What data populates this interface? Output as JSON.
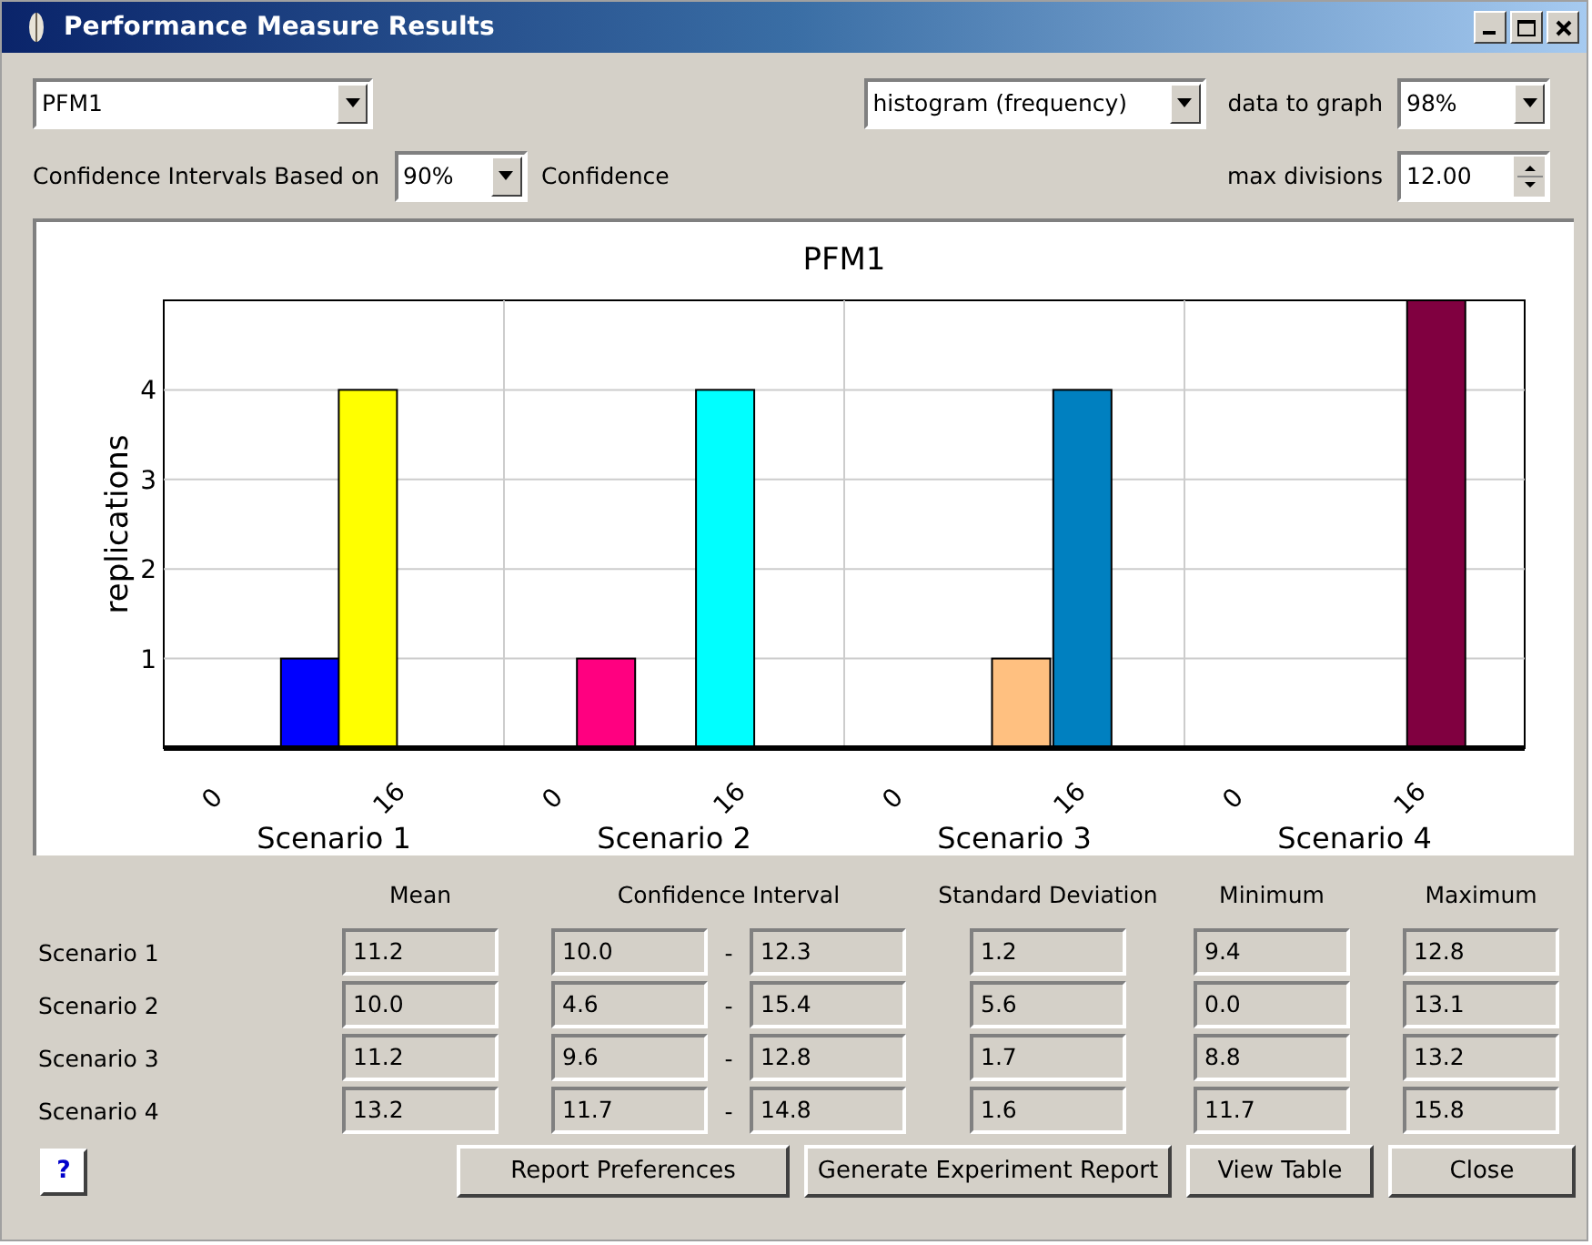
{
  "window": {
    "title": "Performance Measure Results"
  },
  "controls": {
    "measure": "PFM1",
    "graph_type": "histogram (frequency)",
    "data_to_graph_label": "data to graph",
    "data_to_graph": "98%",
    "ci_label": "Confidence Intervals Based on",
    "ci_level": "90%",
    "ci_suffix": "Confidence",
    "max_divisions_label": "max divisions",
    "max_divisions": "12.00"
  },
  "chart": {
    "chart_data": {
      "type": "bar",
      "title": "PFM1",
      "ylabel": "replications",
      "categories": [
        "Scenario 1",
        "Scenario 2",
        "Scenario 3",
        "Scenario 4"
      ],
      "ylim": [
        0,
        5
      ],
      "grid": true,
      "yticks": [
        1,
        2,
        3,
        4
      ],
      "series": [
        {
          "values": [
            1,
            1,
            1,
            null
          ],
          "colors": [
            "#0000ff",
            "#ff0080",
            "#ffc080",
            null
          ]
        },
        {
          "values": [
            4,
            4,
            4,
            5
          ],
          "colors": [
            "#ffff00",
            "#00ffff",
            "#0080c0",
            "#800040"
          ]
        }
      ]
    },
    "bin_labels": [
      [
        "0",
        "16"
      ],
      [
        "0",
        "16"
      ],
      [
        "0",
        "16"
      ],
      [
        "0",
        "16"
      ]
    ]
  },
  "stats": {
    "columns": [
      "Mean",
      "Confidence Interval",
      "Standard Deviation",
      "Minimum",
      "Maximum"
    ],
    "separator": "-",
    "rows": [
      {
        "name": "Scenario 1",
        "mean": "11.2",
        "ci_low": "10.0",
        "ci_high": "12.3",
        "sd": "1.2",
        "min": "9.4",
        "max": "12.8"
      },
      {
        "name": "Scenario 2",
        "mean": "10.0",
        "ci_low": "4.6",
        "ci_high": "15.4",
        "sd": "5.6",
        "min": "0.0",
        "max": "13.1"
      },
      {
        "name": "Scenario 3",
        "mean": "11.2",
        "ci_low": "9.6",
        "ci_high": "12.8",
        "sd": "1.7",
        "min": "8.8",
        "max": "13.2"
      },
      {
        "name": "Scenario 4",
        "mean": "13.2",
        "ci_low": "11.7",
        "ci_high": "14.8",
        "sd": "1.6",
        "min": "11.7",
        "max": "15.8"
      }
    ]
  },
  "help": "?",
  "buttons": [
    "Report Preferences",
    "Generate Experiment Report",
    "View Table",
    "Close"
  ]
}
